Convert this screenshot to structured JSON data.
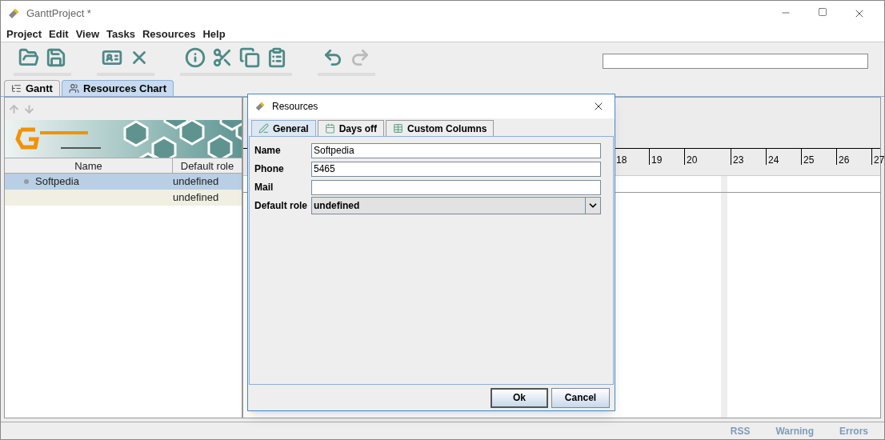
{
  "window": {
    "title": "GanttProject *"
  },
  "menu": [
    "Project",
    "Edit",
    "View",
    "Tasks",
    "Resources",
    "Help"
  ],
  "toolbar": [
    {
      "kind": "open",
      "disabled": false
    },
    {
      "kind": "save",
      "disabled": false
    },
    {
      "kind": "card",
      "disabled": false
    },
    {
      "kind": "delete",
      "disabled": false
    },
    {
      "kind": "info",
      "disabled": false
    },
    {
      "kind": "cut",
      "disabled": false
    },
    {
      "kind": "copy",
      "disabled": false
    },
    {
      "kind": "paste",
      "disabled": false
    },
    {
      "kind": "undo",
      "disabled": false
    },
    {
      "kind": "redo",
      "disabled": true
    }
  ],
  "tabs": [
    {
      "label": "Gantt",
      "selected": false
    },
    {
      "label": "Resources Chart",
      "selected": true
    }
  ],
  "resource_table": {
    "columns": [
      "Name",
      "Default role"
    ],
    "rows": [
      {
        "name": "Softpedia",
        "role": "undefined",
        "selected": true
      },
      {
        "role": "undefined",
        "selected": false
      }
    ]
  },
  "timeline": [
    "18",
    "19",
    "20",
    "23",
    "24",
    "25",
    "26",
    "27"
  ],
  "dialog": {
    "title": "Resources",
    "tabs": [
      {
        "label": "General",
        "selected": true
      },
      {
        "label": "Days off",
        "selected": false
      },
      {
        "label": "Custom Columns",
        "selected": false
      }
    ],
    "fields": [
      {
        "label": "Name",
        "kind": "text",
        "value": "Softpedia"
      },
      {
        "label": "Phone",
        "kind": "text",
        "value": "5465"
      },
      {
        "label": "Mail",
        "kind": "text"
      },
      {
        "label": "Default role",
        "kind": "select",
        "value": "undefined"
      }
    ],
    "buttons": [
      {
        "label": "Ok",
        "default": true
      },
      {
        "label": "Cancel",
        "default": false
      }
    ]
  },
  "status_bar": [
    "RSS",
    "Warning",
    "Errors"
  ]
}
